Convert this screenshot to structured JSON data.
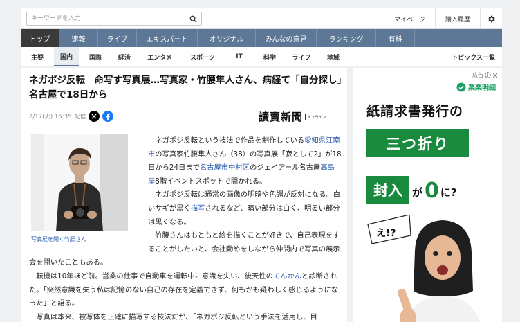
{
  "search": {
    "placeholder": "キーワードを入力"
  },
  "top_links": [
    "マイページ",
    "購入履歴"
  ],
  "main_nav": [
    "トップ",
    "速報",
    "ライブ",
    "エキスパート",
    "オリジナル",
    "みんなの意見",
    "ランキング",
    "有料"
  ],
  "sub_nav": [
    "主要",
    "国内",
    "国際",
    "経済",
    "エンタメ",
    "スポーツ",
    "IT",
    "科学",
    "ライフ",
    "地域"
  ],
  "sub_nav_topics": "トピックス一覧",
  "article": {
    "headline": "ネガポジ反転　命写す写真展…写真家・竹腰隼人さん、病経て「自分探し」　名古屋で18日から",
    "date": "2/17(火) 15:35",
    "date_label": "配信",
    "publisher": "讀賣新聞",
    "publisher_tag": "オンライン",
    "photo_caption": "写真展を開く竹腰さん",
    "p1": {
      "t1": "ネガポジ反転という技法で作品を制作している",
      "l1": "愛知県江南市",
      "t2": "の写真家竹腰隼人さん（38）の写真展「寂として2」が18日から24日まで",
      "l2": "名古屋市中村区",
      "t3": "のジェイアール名古屋",
      "l3": "高島屋",
      "t4": "8階イベントスポットで開かれる。"
    },
    "p2": {
      "t1": "ネガポジ反転は通常の画像の明暗や色調が反対になる。白いサギが黒く",
      "l1": "描写",
      "t2": "されるなど、暗い部分は白く、明るい部分は黒くなる。"
    },
    "p3": "竹腰さんはもともと絵を描くことが好きで、自己表現をすることがしたいと、会社勤めをしながら仲間内で写真の展示会を開いたこともある。",
    "p4": {
      "t1": "転機は10年ほど前。営業の仕事で自動車を運転中に意識を失い、後天性の",
      "l1": "てんかん",
      "t2": "と診断された。「突然意識を失う私は記憶のない自己の存在を定義できず、何もかも疑わしく感じるようになった」と語る。"
    },
    "p5": "写真は本来、被写体を正確に描写する技法だが、「ネガポジ反転という手法を活用し、目"
  },
  "ad": {
    "label": "広告",
    "brand": "楽楽明細",
    "line1": "紙請求書発行の",
    "box1": "三つ折り",
    "box2": "封入",
    "ga": "が",
    "zero": "0",
    "ni": "に?",
    "bubble": "え!?"
  },
  "colors": {
    "nav_bg": "#5c7896",
    "nav_active": "#3a3a3a",
    "link": "#2a5db0",
    "ad_green": "#1a8a3e"
  }
}
